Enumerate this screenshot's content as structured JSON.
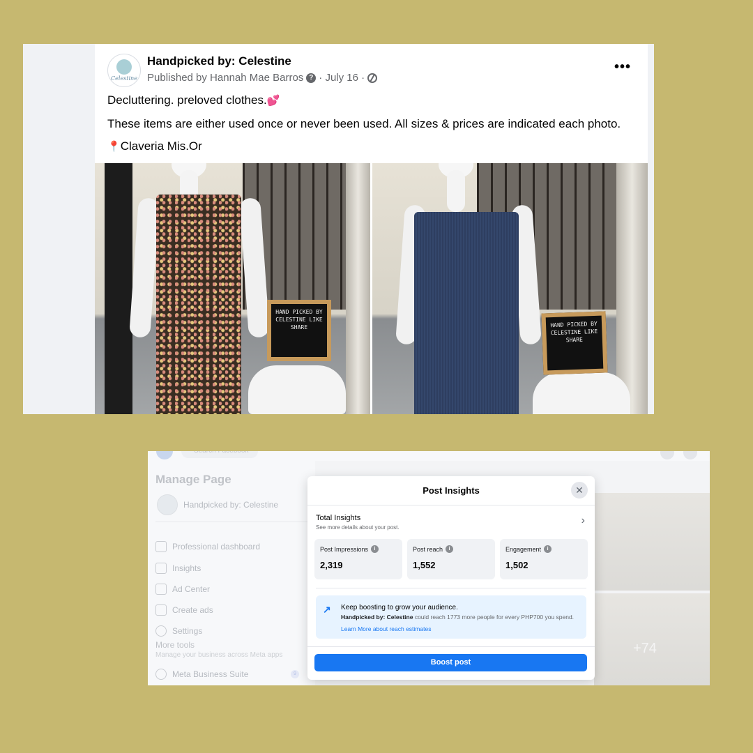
{
  "post": {
    "page_name": "Handpicked by: Celestine",
    "avatar_script": "Celestine",
    "published_by": "Published by Hannah Mae Barros",
    "date": "· July 16 ·",
    "question_mark": "?",
    "more_icon": "•••",
    "line1": "Decluttering. preloved clothes.",
    "line1_emoji": "💕",
    "line2": "These items are either used once or never been used. All sizes & prices are indicated each photo.",
    "line3": "Claveria Mis.Or",
    "line3_emoji": "📍",
    "board_text_1": "HAND PICKED BY CELESTINE LIKE SHARE",
    "board_text_2": "HAND PICKED BY CELESTINE LIKE SHARE"
  },
  "insights_page": {
    "sidebar": {
      "title": "Manage Page",
      "page_name": "Handpicked by: Celestine",
      "items": [
        {
          "label": "Professional dashboard",
          "icon": "dashboard-icon"
        },
        {
          "label": "Insights",
          "icon": "insights-icon"
        },
        {
          "label": "Ad Center",
          "icon": "megaphone-icon"
        },
        {
          "label": "Create ads",
          "icon": "pencil-icon"
        },
        {
          "label": "Settings",
          "icon": "gear-icon"
        }
      ],
      "more_tools": "More tools",
      "more_tools_sub": "Manage your business across Meta apps",
      "meta_suite": "Meta Business Suite",
      "badge": "9"
    },
    "search_placeholder": "Search Facebook",
    "grid_overlay": "+74",
    "modal": {
      "title": "Post Insights",
      "close": "✕",
      "total_title": "Total Insights",
      "total_sub": "See more details about your post.",
      "chevron": "›",
      "metrics": [
        {
          "label": "Post Impressions",
          "value": "2,319"
        },
        {
          "label": "Post reach",
          "value": "1,552"
        },
        {
          "label": "Engagement",
          "value": "1,502"
        }
      ],
      "info_icon": "i",
      "boost_head": "Keep boosting to grow your audience.",
      "boost_name": "Handpicked by: Celestine",
      "boost_desc": " could reach 1773 more people for every PHP700 you spend.",
      "boost_link": "Learn More about reach estimates",
      "boost_button": "Boost post"
    }
  },
  "colors": {
    "background": "#c6b870",
    "facebook_blue": "#1877f2",
    "tip_background": "#e7f3ff"
  }
}
